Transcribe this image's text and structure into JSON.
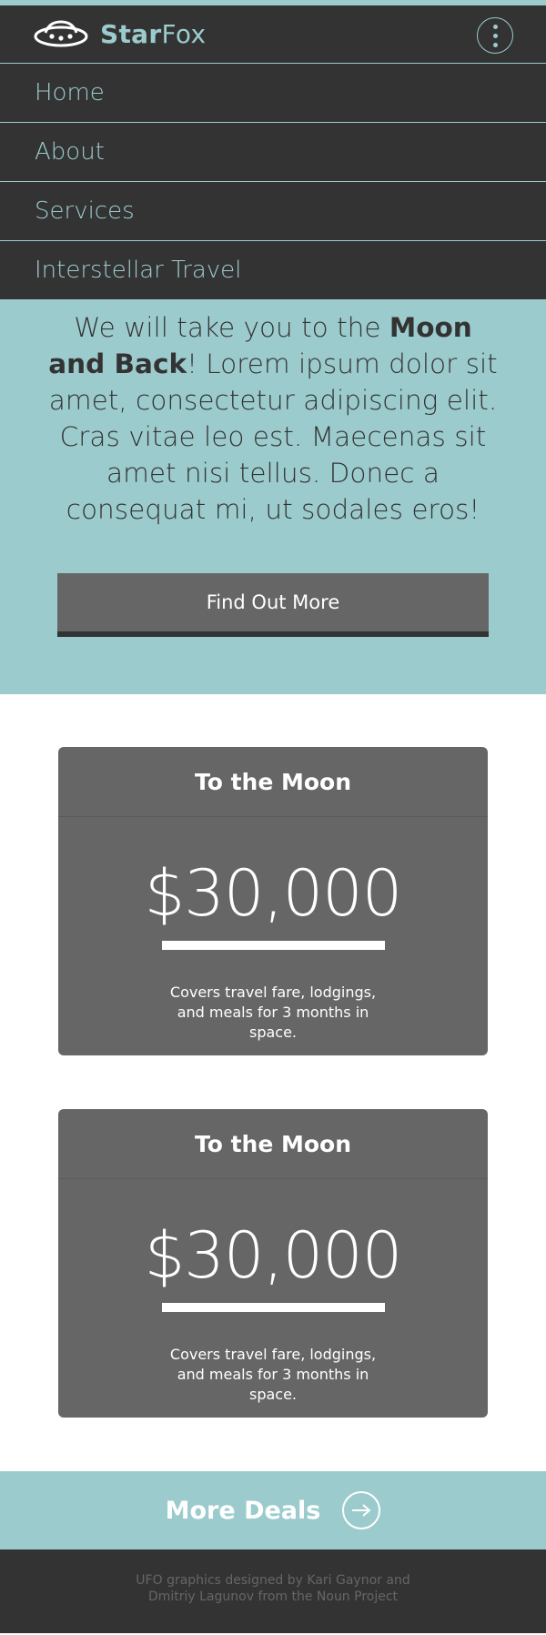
{
  "header": {
    "brand_bold": "Star",
    "brand_light": "Fox",
    "logo_icon": "ufo-icon",
    "menu_icon": "vertical-dots-icon"
  },
  "nav": {
    "items": [
      "Home",
      "About",
      "Services",
      "Interstellar Travel"
    ]
  },
  "hero": {
    "text_before": "We will take you to the ",
    "text_bold": "Moon and Back",
    "text_after": "!  Lorem ipsum dolor sit amet, consectetur adipiscing elit. Cras vitae leo est. Maecenas sit amet nisi tellus. Donec a consequat mi, ut sodales eros!",
    "cta_label": "Find Out More"
  },
  "cards": [
    {
      "title": "To the Moon",
      "price": "$30,000",
      "description": "Covers travel fare, lodgings, and meals for 3 months in space."
    },
    {
      "title": "To the Moon",
      "price": "$30,000",
      "description": "Covers travel fare, lodgings, and meals for 3 months in space."
    }
  ],
  "deals": {
    "label": "More Deals",
    "icon": "arrow-right-circle-icon"
  },
  "footer": {
    "credit": "UFO graphics designed by Kari Gaynor and Dmitriy Lagunov from the Noun Project"
  },
  "colors": {
    "accent": "#9ccbcd",
    "dark": "#333333",
    "card": "#666666"
  }
}
